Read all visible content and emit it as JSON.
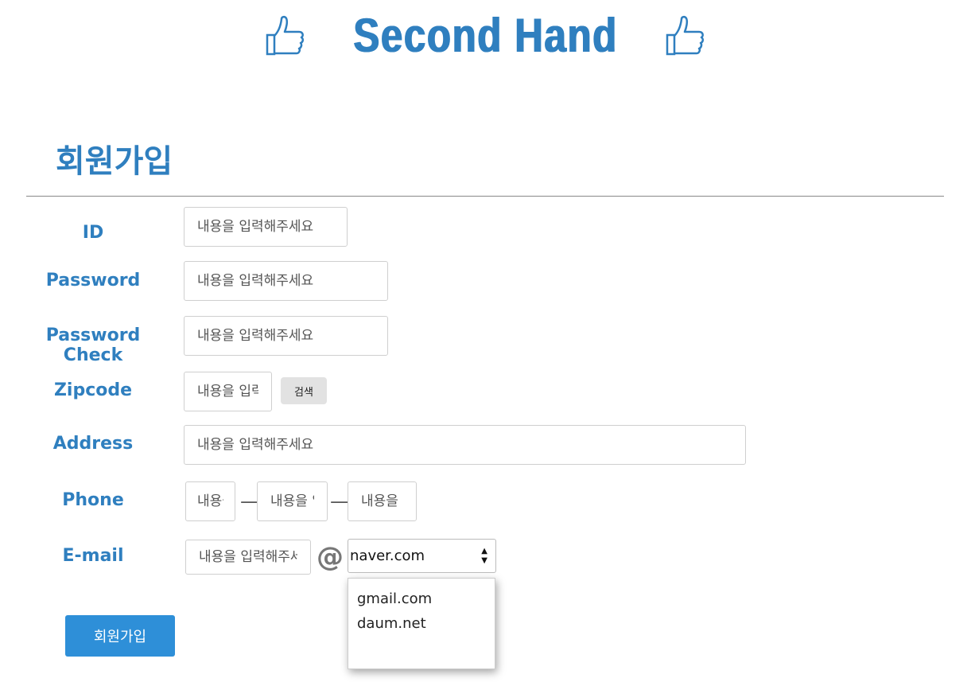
{
  "header": {
    "logo_text": "Second Hand",
    "logo_icon": "thumbs-up-icon",
    "brand_color": "#2f7fbf"
  },
  "page_title": "회원가입",
  "form": {
    "placeholder": "내용을 입력해주세요",
    "labels": {
      "id": "ID",
      "password": "Password",
      "password_check": "Password Check",
      "zipcode": "Zipcode",
      "address": "Address",
      "phone": "Phone",
      "email": "E-mail"
    },
    "zipcode_search_label": "검색",
    "phone_separator": "—",
    "email_at": "@",
    "email_domain": {
      "selected": "naver.com",
      "options": [
        "gmail.com",
        "daum.net"
      ]
    },
    "submit_label": "회원가입",
    "accent_color": "#2e8fd8"
  }
}
